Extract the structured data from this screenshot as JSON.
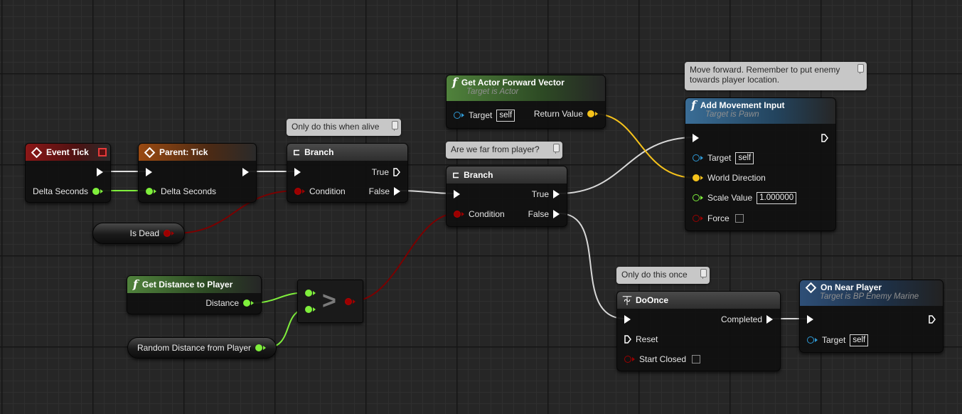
{
  "graph": {
    "event_tick": {
      "title": "Event Tick",
      "delta_label": "Delta Seconds"
    },
    "parent_tick": {
      "title": "Parent: Tick",
      "delta_label": "Delta Seconds"
    },
    "branch1": {
      "title": "Branch",
      "condition_label": "Condition",
      "true_label": "True",
      "false_label": "False",
      "comment": "Only do this when alive"
    },
    "is_dead": {
      "label": "Is Dead"
    },
    "get_actor_forward": {
      "title": "Get Actor Forward Vector",
      "subtitle": "Target is Actor",
      "target_label": "Target",
      "target_value": "self",
      "return_label": "Return Value"
    },
    "branch2": {
      "title": "Branch",
      "condition_label": "Condition",
      "true_label": "True",
      "false_label": "False",
      "comment": "Are we far from player?"
    },
    "add_movement": {
      "title": "Add Movement Input",
      "subtitle": "Target is Pawn",
      "comment": "Move forward. Remember to put enemy towards player location.",
      "target_label": "Target",
      "target_value": "self",
      "world_direction_label": "World Direction",
      "scale_label": "Scale Value",
      "scale_value": "1.000000",
      "force_label": "Force"
    },
    "get_distance": {
      "title": "Get Distance to Player",
      "distance_label": "Distance"
    },
    "compare": {
      "symbol": ">"
    },
    "random_distance": {
      "label": "Random Distance from Player"
    },
    "do_once": {
      "title": "DoOnce",
      "comment": "Only do this once",
      "completed_label": "Completed",
      "reset_label": "Reset",
      "start_closed_label": "Start Closed"
    },
    "on_near_player": {
      "title": "On Near Player",
      "subtitle": "Target is BP Enemy Marine",
      "target_label": "Target",
      "target_value": "self"
    }
  },
  "colors": {
    "exec_wire": "#e6e6e6",
    "float_wire": "#7fef3c",
    "bool_wire": "#7a0000",
    "vector_wire": "#f5c21b"
  }
}
